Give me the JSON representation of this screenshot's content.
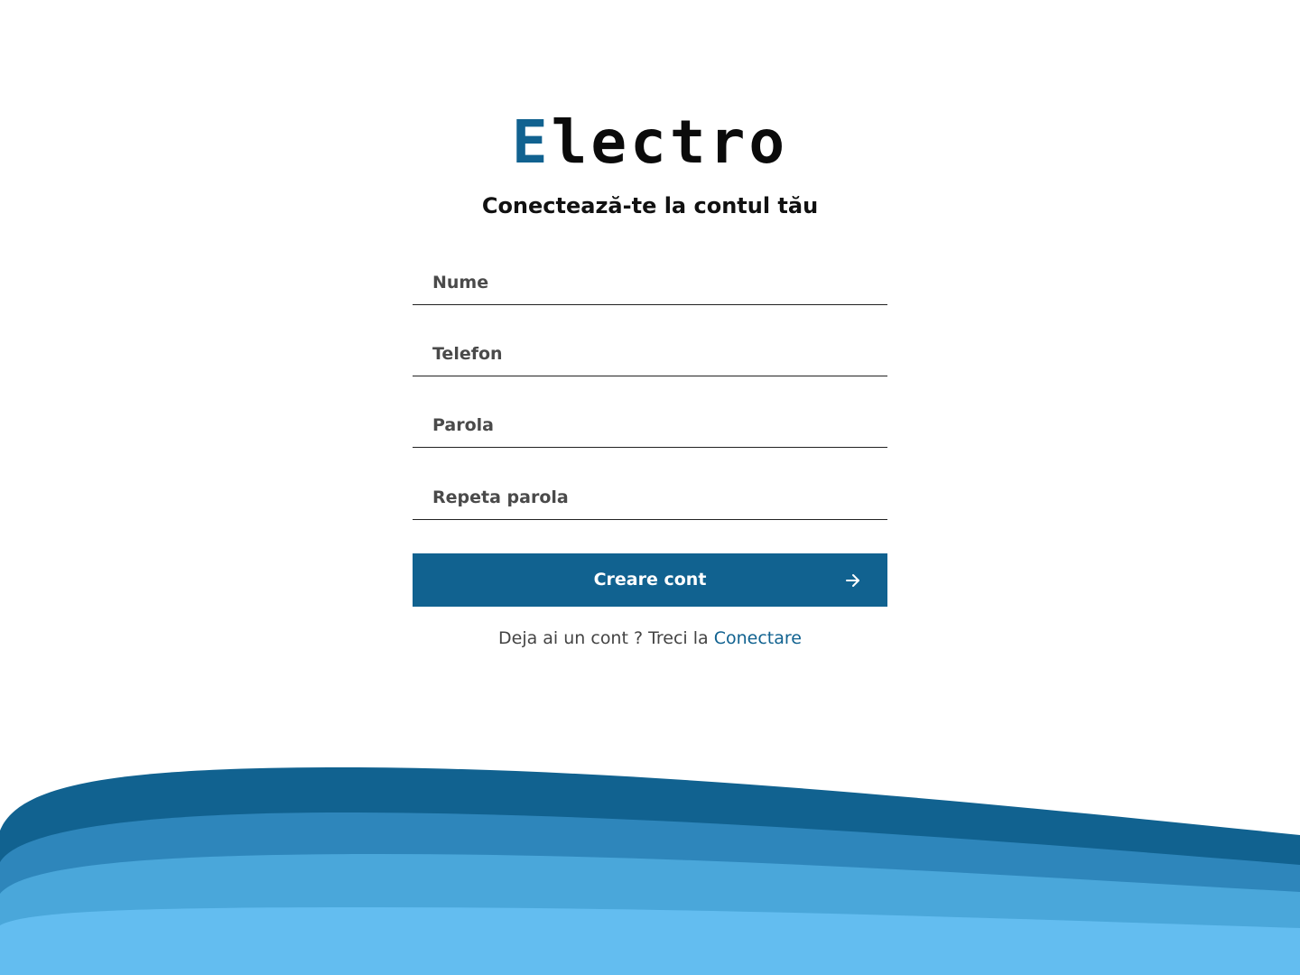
{
  "brand": {
    "logo_first_letter": "E",
    "logo_rest": "lectro",
    "accent_color": "#116290"
  },
  "heading": {
    "title": "Conectează-te la contul tău"
  },
  "form": {
    "name_placeholder": "Nume",
    "phone_placeholder": "Telefon",
    "password_placeholder": "Parola",
    "repeat_password_placeholder": "Repeta parola",
    "submit_label": "Creare cont",
    "submit_icon": "arrow-right-icon"
  },
  "footer": {
    "prompt_text": "Deja ai un cont ? Treci la",
    "login_link": "Conectare"
  },
  "colors": {
    "primary": "#116290",
    "wave_dark": "#116290",
    "wave_mid": "#2e86bb",
    "wave_light": "#4aa7da",
    "wave_lightest": "#63bdf0"
  }
}
